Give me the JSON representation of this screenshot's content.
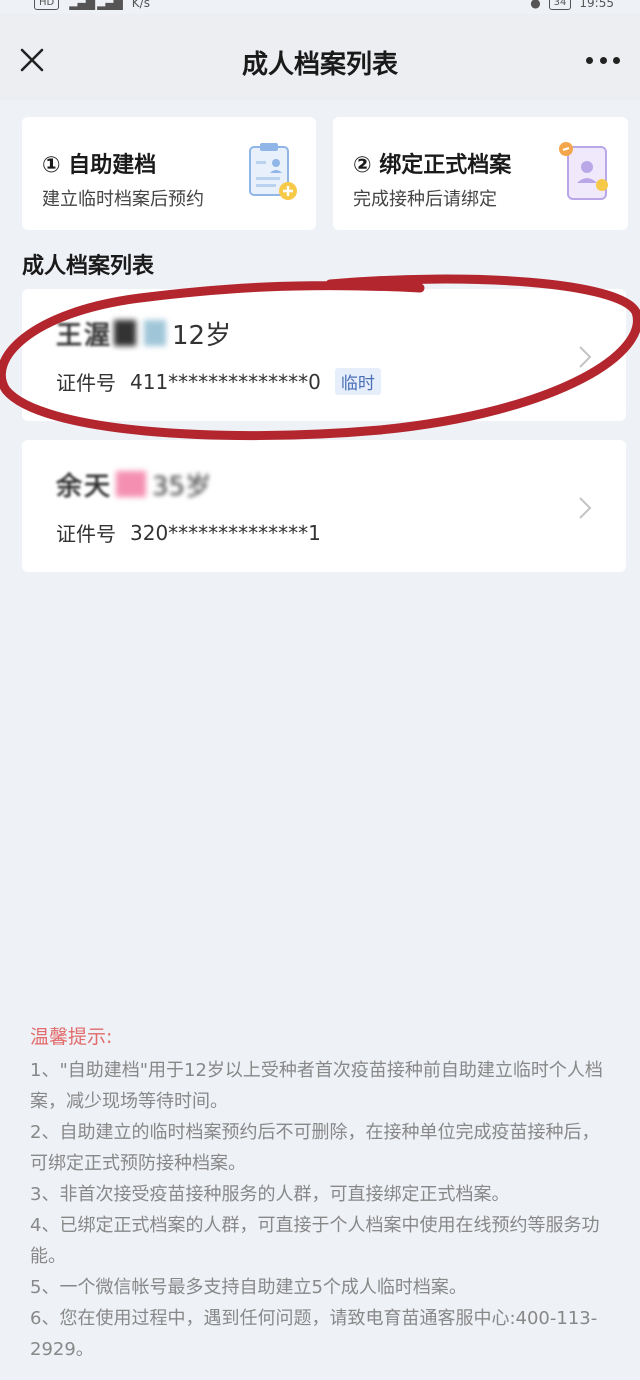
{
  "statusbar": {
    "hd_badge": "HD",
    "speed": "K/s",
    "battery": "34",
    "time": "19:55"
  },
  "navbar": {
    "title": "成人档案列表"
  },
  "actions": [
    {
      "title": "① 自助建档",
      "subtitle": "建立临时档案后预约",
      "icon": "clipboard-add-icon"
    },
    {
      "title": "② 绑定正式档案",
      "subtitle": "完成接种后请绑定",
      "icon": "phone-user-link-icon"
    }
  ],
  "section_title": "成人档案列表",
  "archives": [
    {
      "name": "王渥",
      "age": "12岁",
      "id_label": "证件号",
      "id_number": "411**************0",
      "tag": "临时"
    },
    {
      "name": "余天",
      "age": "35岁",
      "id_label": "证件号",
      "id_number": "320**************1",
      "tag": ""
    }
  ],
  "tips": {
    "title": "温馨提示:",
    "items": [
      "1、\"自助建档\"用于12岁以上受种者首次疫苗接种前自助建立临时个人档案，减少现场等待时间。",
      "2、自助建立的临时档案预约后不可删除，在接种单位完成疫苗接种后，可绑定正式预防接种档案。",
      "3、非首次接受疫苗接种服务的人群，可直接绑定正式档案。",
      "4、已绑定正式档案的人群，可直接于个人档案中使用在线预约等服务功能。",
      "5、一个微信帐号最多支持自助建立5个成人临时档案。",
      "6、您在使用过程中，遇到任何问题，请致电育苗通客服中心:400-113-2929。"
    ]
  },
  "colors": {
    "background": "#eef1f6",
    "tip_title": "#e26b6b",
    "tag_bg": "#e6eefb",
    "tag_text": "#4a6fb5",
    "marker": "#b3262e"
  }
}
